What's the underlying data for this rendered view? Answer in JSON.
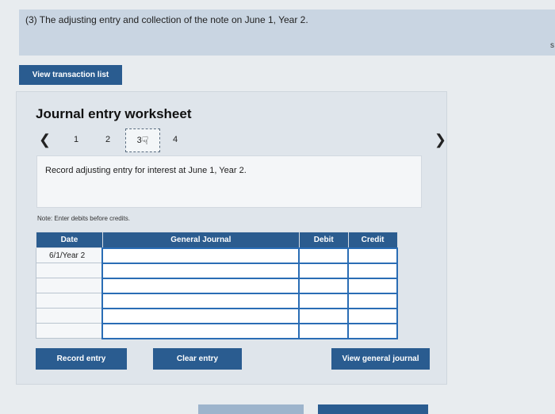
{
  "question": {
    "text": "(3) The adjusting entry and collection of the note on June 1, Year 2."
  },
  "right_edge_char": "s",
  "view_transaction_list": "View transaction list",
  "worksheet": {
    "title": "Journal entry worksheet",
    "steps": [
      "1",
      "2",
      "3",
      "4"
    ],
    "active_step": "3",
    "prev_icon": "chevron-left-icon",
    "next_icon": "chevron-right-icon",
    "instruction": "Record adjusting entry for interest at June 1, Year 2.",
    "note": "Note: Enter debits before credits.",
    "table": {
      "headers": {
        "date": "Date",
        "account": "General Journal",
        "debit": "Debit",
        "credit": "Credit"
      },
      "rows": [
        {
          "date": "6/1/Year 2"
        },
        {
          "date": ""
        },
        {
          "date": ""
        },
        {
          "date": ""
        },
        {
          "date": ""
        },
        {
          "date": ""
        }
      ]
    },
    "buttons": {
      "record": "Record entry",
      "clear": "Clear entry",
      "view_general": "View general journal"
    }
  },
  "colors": {
    "primary_button": "#2a5c90",
    "table_header": "#2b5c8f",
    "question_bar": "#c9d5e2",
    "input_border": "#2a6db5"
  }
}
